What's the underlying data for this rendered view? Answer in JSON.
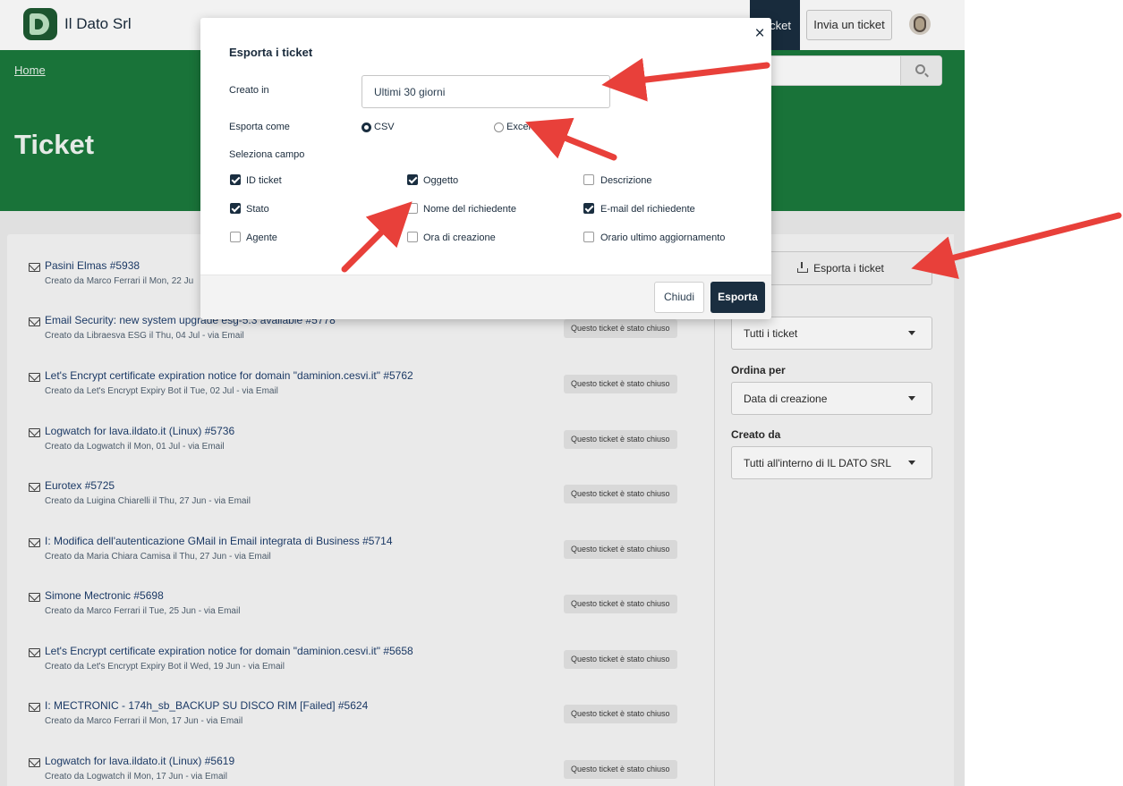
{
  "header": {
    "brand": "Il Dato Srl",
    "nav_ticket_label": "icket",
    "nav_invia_label": "Invia un ticket"
  },
  "hero": {
    "breadcrumb": "Home",
    "title": "Ticket"
  },
  "tickets": [
    {
      "title": "Pasini Elmas #5938",
      "meta": "Creato da Marco Ferrari il Mon, 22 Ju",
      "status": ""
    },
    {
      "title": "Email Security: new system upgrade esg-5.3 available #5778",
      "meta": "Creato da Libraesva ESG il Thu, 04 Jul - via Email",
      "status": "Questo ticket è stato chiuso"
    },
    {
      "title": "Let's Encrypt certificate expiration notice for domain \"daminion.cesvi.it\" #5762",
      "meta": "Creato da Let's Encrypt Expiry Bot il Tue, 02 Jul - via Email",
      "status": "Questo ticket è stato chiuso"
    },
    {
      "title": "Logwatch for lava.ildato.it (Linux) #5736",
      "meta": "Creato da Logwatch il Mon, 01 Jul - via Email",
      "status": "Questo ticket è stato chiuso"
    },
    {
      "title": "Eurotex #5725",
      "meta": "Creato da Luigina Chiarelli il Thu, 27 Jun - via Email",
      "status": "Questo ticket è stato chiuso"
    },
    {
      "title": "I: Modifica dell'autenticazione GMail in Email integrata di Business #5714",
      "meta": "Creato da Maria Chiara Camisa il Thu, 27 Jun - via Email",
      "status": "Questo ticket è stato chiuso"
    },
    {
      "title": "Simone Mectronic #5698",
      "meta": "Creato da Marco Ferrari il Tue, 25 Jun - via Email",
      "status": "Questo ticket è stato chiuso"
    },
    {
      "title": "Let's Encrypt certificate expiration notice for domain \"daminion.cesvi.it\" #5658",
      "meta": "Creato da Let's Encrypt Expiry Bot il Wed, 19 Jun - via Email",
      "status": "Questo ticket è stato chiuso"
    },
    {
      "title": "I: MECTRONIC - 174h_sb_BACKUP SU DISCO RIM [Failed] #5624",
      "meta": "Creato da Marco Ferrari il Mon, 17 Jun - via Email",
      "status": "Questo ticket è stato chiuso"
    },
    {
      "title": "Logwatch for lava.ildato.it (Linux) #5619",
      "meta": "Creato da Logwatch il Mon, 17 Jun - via Email",
      "status": "Questo ticket è stato chiuso"
    }
  ],
  "sidebar": {
    "export_button": "Esporta i ticket",
    "filter_value": "Tutti i ticket",
    "sort_label": "Ordina per",
    "sort_value": "Data di creazione",
    "created_by_label": "Creato da",
    "created_by_value": "Tutti all'interno di IL DATO SRL"
  },
  "modal": {
    "title": "Esporta i ticket",
    "close_glyph": "×",
    "created_in_label": "Creato in",
    "created_in_value": "Ultimi 30 giorni",
    "export_as_label": "Esporta come",
    "format_options": [
      {
        "label": "CSV",
        "selected": true
      },
      {
        "label": "Excel",
        "selected": false
      }
    ],
    "fields_label": "Seleziona campo",
    "fields": [
      {
        "label": "ID ticket",
        "checked": true
      },
      {
        "label": "Oggetto",
        "checked": true
      },
      {
        "label": "Descrizione",
        "checked": false
      },
      {
        "label": "Stato",
        "checked": true
      },
      {
        "label": "Nome del richiedente",
        "checked": false
      },
      {
        "label": "E-mail del richiedente",
        "checked": true
      },
      {
        "label": "Agente",
        "checked": false
      },
      {
        "label": "Ora di creazione",
        "checked": false
      },
      {
        "label": "Orario ultimo aggiornamento",
        "checked": false
      }
    ],
    "cancel_label": "Chiudi",
    "submit_label": "Esporta"
  },
  "colors": {
    "primary": "#1a2e40",
    "hero_green": "#1b7a3d",
    "annotation_red": "#e8403a"
  },
  "icons": [
    "logo-icon",
    "search-icon",
    "mail-icon",
    "download-icon",
    "chevron-down-icon",
    "close-icon",
    "avatar"
  ]
}
